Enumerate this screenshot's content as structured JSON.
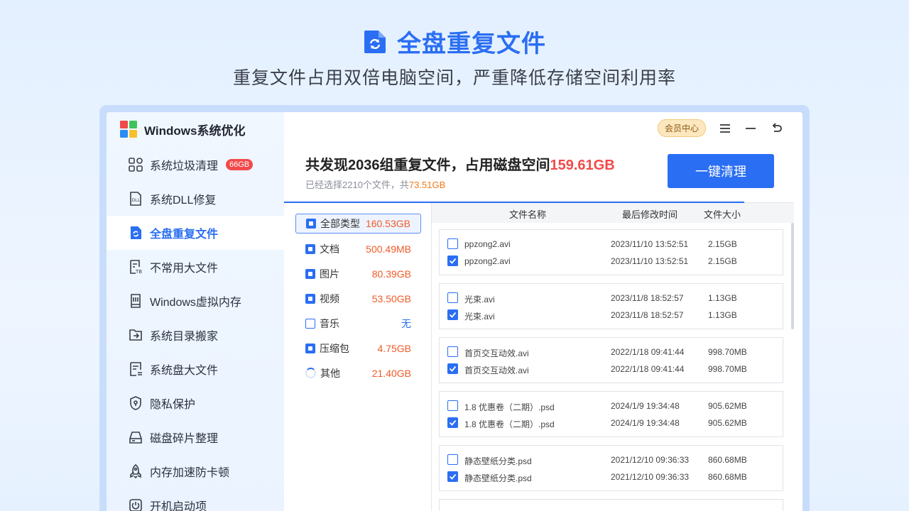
{
  "hero": {
    "title": "全盘重复文件",
    "subtitle": "重复文件占用双倍电脑空间，严重降低存储空间利用率"
  },
  "app": {
    "name": "Windows系统优化"
  },
  "sidebar": {
    "items": [
      {
        "label": "系统垃圾清理",
        "icon": "grid-icon",
        "badge": "66GB"
      },
      {
        "label": "系统DLL修复",
        "icon": "dll-file-icon"
      },
      {
        "label": "全盘重复文件",
        "icon": "duplicate-file-icon",
        "active": true
      },
      {
        "label": "不常用大文件",
        "icon": "tb-file-icon"
      },
      {
        "label": "Windows虚拟内存",
        "icon": "memory-icon"
      },
      {
        "label": "系统目录搬家",
        "icon": "folder-move-icon"
      },
      {
        "label": "系统盘大文件",
        "icon": "list-file-icon"
      },
      {
        "label": "隐私保护",
        "icon": "shield-icon"
      },
      {
        "label": "磁盘碎片整理",
        "icon": "disk-icon"
      },
      {
        "label": "内存加速防卡顿",
        "icon": "rocket-icon"
      },
      {
        "label": "开机启动项",
        "icon": "power-icon"
      }
    ]
  },
  "topbar": {
    "vip_label": "会员中心"
  },
  "summary": {
    "prefix": "共发现2036组重复文件，占用磁盘空间",
    "size": "159.61GB",
    "selected_prefix": "已经选择2210个文件，共",
    "selected_size": "73.51GB",
    "clean_button": "一键清理"
  },
  "categories": [
    {
      "name": "全部类型",
      "size": "160.53GB",
      "state": "fill",
      "active": true
    },
    {
      "name": "文档",
      "size": "500.49MB",
      "state": "fill"
    },
    {
      "name": "图片",
      "size": "80.39GB",
      "state": "fill"
    },
    {
      "name": "视频",
      "size": "53.50GB",
      "state": "fill"
    },
    {
      "name": "音乐",
      "size": "无",
      "state": "empty"
    },
    {
      "name": "压缩包",
      "size": "4.75GB",
      "state": "fill"
    },
    {
      "name": "其他",
      "size": "21.40GB",
      "state": "loading"
    }
  ],
  "table": {
    "headers": {
      "name": "文件名称",
      "time": "最后修改时间",
      "size": "文件大小"
    },
    "groups": [
      {
        "rows": [
          {
            "name": "ppzong2.avi",
            "time": "2023/11/10 13:52:51",
            "size": "2.15GB",
            "checked": false
          },
          {
            "name": "ppzong2.avi",
            "time": "2023/11/10 13:52:51",
            "size": "2.15GB",
            "checked": true
          }
        ]
      },
      {
        "rows": [
          {
            "name": "光束.avi",
            "time": "2023/11/8 18:52:57",
            "size": "1.13GB",
            "checked": false
          },
          {
            "name": "光束.avi",
            "time": "2023/11/8 18:52:57",
            "size": "1.13GB",
            "checked": true
          }
        ]
      },
      {
        "rows": [
          {
            "name": "首页交互动效.avi",
            "time": "2022/1/18 09:41:44",
            "size": "998.70MB",
            "checked": false
          },
          {
            "name": "首页交互动效.avi",
            "time": "2022/1/18 09:41:44",
            "size": "998.70MB",
            "checked": true
          }
        ]
      },
      {
        "rows": [
          {
            "name": "1.8 优惠卷（二期）.psd",
            "time": "2024/1/9 19:34:48",
            "size": "905.62MB",
            "checked": false
          },
          {
            "name": "1.8 优惠卷（二期）.psd",
            "time": "2024/1/9 19:34:48",
            "size": "905.62MB",
            "checked": true
          }
        ]
      },
      {
        "rows": [
          {
            "name": "静态壁纸分类.psd",
            "time": "2021/12/10 09:36:33",
            "size": "860.68MB",
            "checked": false
          },
          {
            "name": "静态壁纸分类.psd",
            "time": "2021/12/10 09:36:33",
            "size": "860.68MB",
            "checked": true
          }
        ]
      }
    ]
  },
  "colors": {
    "accent": "#2a6ef3",
    "danger": "#f24a4a",
    "size_orange": "#f05a28"
  }
}
